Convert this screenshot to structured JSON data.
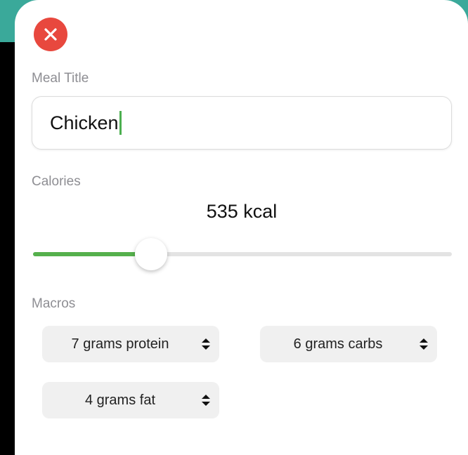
{
  "form": {
    "meal_title_label": "Meal Title",
    "meal_title_value": "Chicken",
    "calories_label": "Calories",
    "calories_display": "535 kcal",
    "calories_slider_fraction": 0.282,
    "macros_label": "Macros",
    "macros": [
      {
        "label": "7 grams protein"
      },
      {
        "label": "6 grams carbs"
      },
      {
        "label": "4 grams fat"
      }
    ]
  },
  "colors": {
    "close_button": "#e8483e",
    "accent_green": "#55b04c",
    "header_teal": "#3aa99a"
  },
  "icons": {
    "close": "close-x-icon",
    "picker": "chevron-up-down-icon"
  }
}
